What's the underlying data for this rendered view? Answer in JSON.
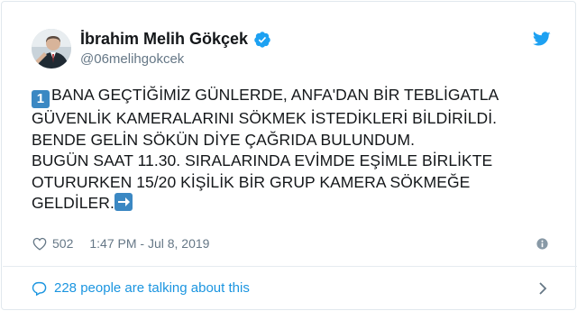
{
  "author": {
    "name": "İbrahim Melih Gökçek",
    "handle": "@06melihgokcek"
  },
  "icons": {
    "avatar": "profile-photo",
    "verified": "verified-badge-icon",
    "platform": "twitter-bird-icon",
    "like": "heart-icon",
    "info": "info-icon",
    "conversation": "speech-bubble-icon",
    "more": "chevron-right-icon",
    "emoji_number": "keycap-1-emoji",
    "emoji_arrow": "right-arrow-emoji"
  },
  "colors": {
    "accent": "#1b95e0",
    "verified": "#1da1f2",
    "muted": "#657786",
    "emoji_blue": "#3b88c3"
  },
  "tweet": {
    "emoji_number": "1",
    "lines": [
      "BANA GEÇTİĞİMİZ GÜNLERDE, ANFA'DAN BİR TEBLİGATLA",
      "GÜVENLİK KAMERALARINI SÖKMEK İSTEDİKLERİ BİLDİRİLDİ.",
      "BENDE GELİN SÖKÜN DİYE ÇAĞRIDA BULUNDUM.",
      "BUGÜN SAAT 11.30. SIRALARINDA EVİMDE EŞİMLE BİRLİKTE",
      "OTURURKEN 15/20 KİŞİLİK BİR GRUP KAMERA SÖKMEĞE",
      "GELDİLER."
    ]
  },
  "meta": {
    "likes": "502",
    "timestamp": "1:47 PM - Jul 8, 2019"
  },
  "footer": {
    "talking": "228 people are talking about this"
  }
}
